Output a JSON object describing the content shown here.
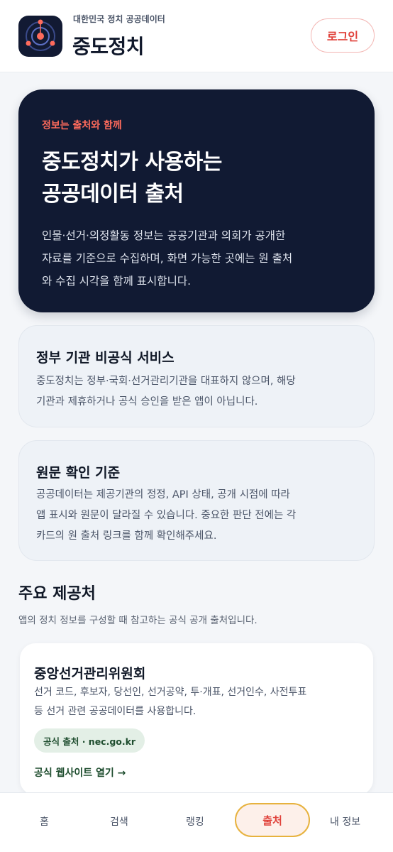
{
  "header": {
    "org_label": "대한민국 정치 공공데이터",
    "app_title": "중도정치",
    "login_label": "로그인"
  },
  "hero": {
    "eyebrow": "정보는 출처와 함께",
    "title_line1": "중도정치가 사용하는",
    "title_line2": "공공데이터 출처",
    "desc_line1": "인물·선거·의정활동 정보는 공공기관과 의회가 공개한",
    "desc_line2": "자료를 기준으로 수집하며, 화면 가능한 곳에는 원 출처",
    "desc_line3": "와 수집 시각을 함께 표시합니다."
  },
  "notice_unofficial": {
    "title": "정부 기관 비공식 서비스",
    "desc_line1": "중도정치는 정부·국회·선거관리기관을 대표하지 않으며, 해당",
    "desc_line2": "기관과 제휴하거나 공식 승인을 받은 앱이 아닙니다."
  },
  "notice_verify": {
    "title": "원문 확인 기준",
    "desc_line1": "공공데이터는 제공기관의 정정, API 상태, 공개 시점에 따라",
    "desc_line2": "앱 표시와 원문이 달라질 수 있습니다. 중요한 판단 전에는 각",
    "desc_line3": "카드의 원 출처 링크를 함께 확인해주세요."
  },
  "sources_section": {
    "title": "주요 제공처",
    "subtitle": "앱의 정치 정보를 구성할 때 참고하는 공식 공개 출처입니다."
  },
  "sources": [
    {
      "name": "중앙선거관리위원회",
      "desc_line1": "선거 코드, 후보자, 당선인, 선거공약, 투·개표, 선거인수, 사전투표",
      "desc_line2": "등 선거 관련 공공데이터를 사용합니다.",
      "badge": "공식 출처 · nec.go.kr",
      "link_label": "공식 웹사이트 열기 →"
    }
  ],
  "tabbar": {
    "home": "홈",
    "search": "검색",
    "ranking": "랭킹",
    "sources": "출처",
    "my_info": "내 정보"
  },
  "colors": {
    "navy": "#111a33",
    "accent_red": "#e0413a",
    "eyebrow_coral": "#ff6b5c",
    "badge_green": "#1e4d2e",
    "active_tab_border": "#e7b23e"
  },
  "icons": {
    "logo": "orbit-compass-logo-icon"
  }
}
